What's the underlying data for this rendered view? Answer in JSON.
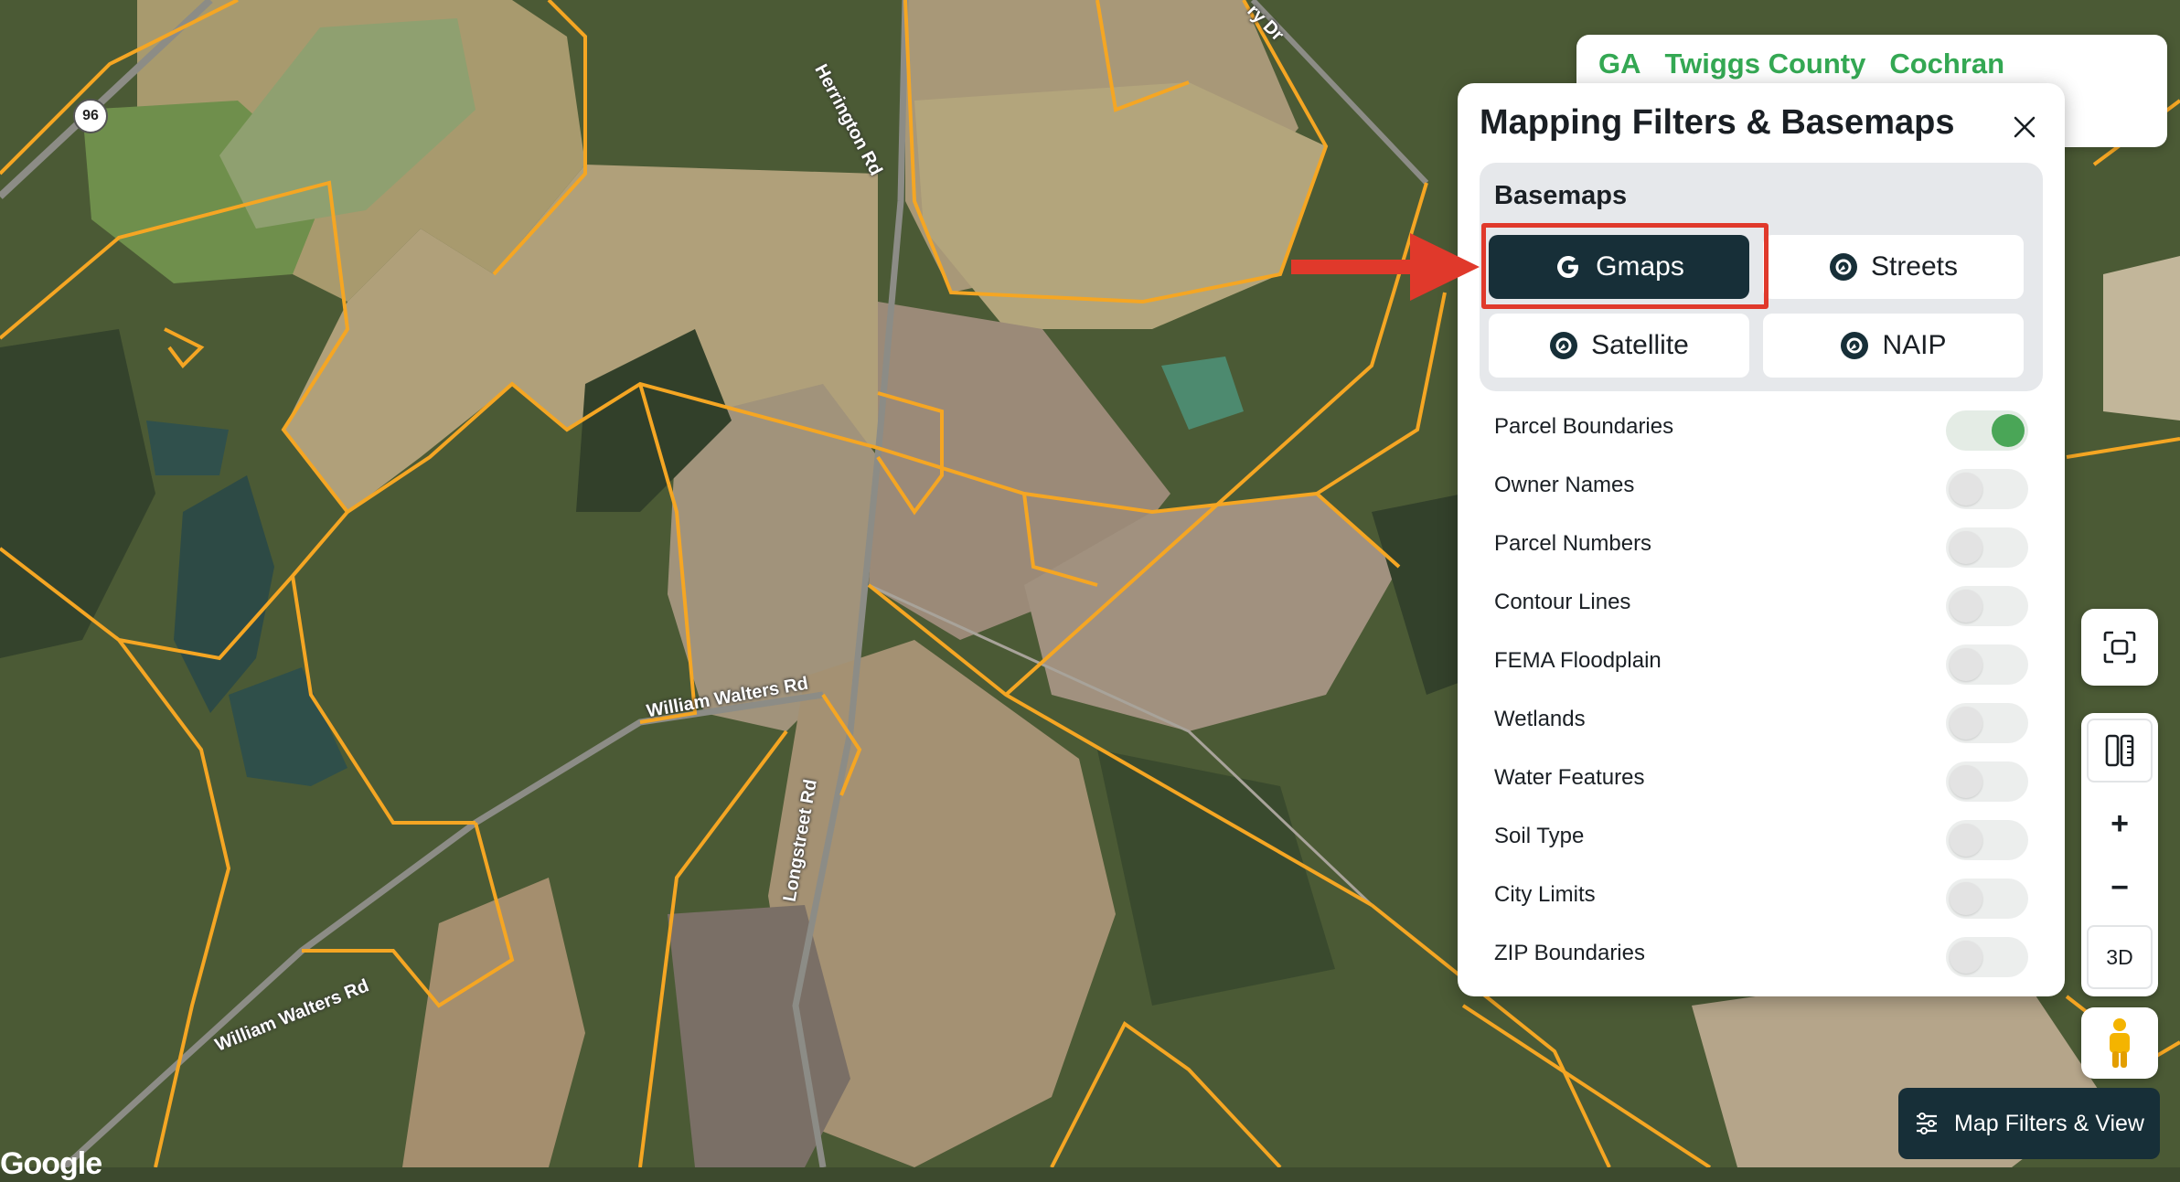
{
  "breadcrumb": {
    "state": "GA",
    "county": "Twiggs County",
    "city": "Cochran"
  },
  "panel": {
    "title": "Mapping Filters & Basemaps",
    "basemaps_title": "Basemaps",
    "basemaps": [
      {
        "label": "Gmaps",
        "icon": "google-g-icon",
        "active": true
      },
      {
        "label": "Streets",
        "icon": "compass-icon",
        "active": false
      },
      {
        "label": "Satellite",
        "icon": "compass-icon",
        "active": false
      },
      {
        "label": "NAIP",
        "icon": "compass-icon",
        "active": false
      }
    ],
    "layers": [
      {
        "label": "Parcel Boundaries",
        "on": true
      },
      {
        "label": "Owner Names",
        "on": false
      },
      {
        "label": "Parcel Numbers",
        "on": false
      },
      {
        "label": "Contour Lines",
        "on": false
      },
      {
        "label": "FEMA Floodplain",
        "on": false
      },
      {
        "label": "Wetlands",
        "on": false
      },
      {
        "label": "Water Features",
        "on": false
      },
      {
        "label": "Soil Type",
        "on": false
      },
      {
        "label": "City Limits",
        "on": false
      },
      {
        "label": "ZIP Boundaries",
        "on": false
      }
    ]
  },
  "controls": {
    "zoom_in": "+",
    "zoom_out": "−",
    "three_d": "3D",
    "filters_button": "Map Filters & View"
  },
  "map": {
    "roads": [
      "Herrington Rd",
      "William Walters Rd",
      "William Walters Rd",
      "Longstreet Rd",
      "ry Dr"
    ],
    "route_shield": "96",
    "attribution": "Google"
  },
  "colors": {
    "parcel_line": "#f5a623",
    "accent_green": "#34a853",
    "dark_button": "#172f38",
    "annotation_red": "#e0392b"
  }
}
